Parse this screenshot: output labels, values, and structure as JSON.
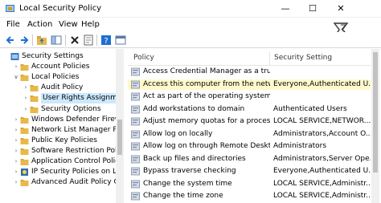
{
  "window": {
    "title": "Local Security Policy",
    "controls": {
      "minimize": "—",
      "maximize": "☐",
      "close": "✕"
    }
  },
  "menu": [
    "File",
    "Action",
    "View",
    "Help"
  ],
  "toolbar": {
    "buttons": [
      "back-icon",
      "forward-icon",
      "up-folder-icon",
      "show-hide-tree-icon",
      "delete-icon",
      "properties-icon",
      "help-icon",
      "console-icon"
    ]
  },
  "tree": {
    "items": [
      {
        "label": "Security Settings",
        "level": 0,
        "expanded": true,
        "icon": "security-settings-icon"
      },
      {
        "label": "Account Policies",
        "level": 1,
        "expanded": false,
        "icon": "folder-icon"
      },
      {
        "label": "Local Policies",
        "level": 1,
        "expanded": true,
        "icon": "folder-icon"
      },
      {
        "label": "Audit Policy",
        "level": 2,
        "expanded": false,
        "icon": "folder-icon"
      },
      {
        "label": "User Rights Assignment",
        "level": 2,
        "expanded": false,
        "icon": "folder-icon",
        "selected": true
      },
      {
        "label": "Security Options",
        "level": 2,
        "expanded": false,
        "icon": "folder-icon"
      },
      {
        "label": "Windows Defender Firewall w",
        "level": 1,
        "expanded": false,
        "icon": "folder-icon"
      },
      {
        "label": "Network List Manager Polic",
        "level": 1,
        "expanded": false,
        "icon": "folder-icon"
      },
      {
        "label": "Public Key Policies",
        "level": 1,
        "expanded": false,
        "icon": "folder-icon"
      },
      {
        "label": "Software Restriction Policies",
        "level": 1,
        "expanded": false,
        "icon": "folder-icon"
      },
      {
        "label": "Application Control Policies",
        "level": 1,
        "expanded": false,
        "icon": "folder-icon"
      },
      {
        "label": "IP Security Policies on Local",
        "level": 1,
        "expanded": false,
        "icon": "ip-security-icon"
      },
      {
        "label": "Advanced Audit Policy Conf",
        "level": 1,
        "expanded": false,
        "icon": "folder-icon"
      }
    ]
  },
  "list": {
    "columns": [
      "Policy",
      "Security Setting"
    ],
    "rows": [
      {
        "policy": "Access Credential Manager as a trusted...",
        "setting": ""
      },
      {
        "policy": "Access this computer from the network",
        "setting": "Everyone,Authenticated U...",
        "selected": true
      },
      {
        "policy": "Act as part of the operating system",
        "setting": ""
      },
      {
        "policy": "Add workstations to domain",
        "setting": "Authenticated Users"
      },
      {
        "policy": "Adjust memory quotas for a process",
        "setting": "LOCAL SERVICE,NETWOR..."
      },
      {
        "policy": "Allow log on locally",
        "setting": "Administrators,Account O..."
      },
      {
        "policy": "Allow log on through Remote Desktop ...",
        "setting": "Administrators"
      },
      {
        "policy": "Back up files and directories",
        "setting": "Administrators,Server Ope..."
      },
      {
        "policy": "Bypass traverse checking",
        "setting": "Everyone,Authenticated U..."
      },
      {
        "policy": "Change the system time",
        "setting": "LOCAL SERVICE,Administr..."
      },
      {
        "policy": "Change the time zone",
        "setting": "LOCAL SERVICE,Administr..."
      }
    ]
  },
  "colors": {
    "selection_tree": "#cce8ff",
    "selection_list": "#fff9cc",
    "folder": "#e8b84a",
    "close_hover": "#e81123"
  }
}
